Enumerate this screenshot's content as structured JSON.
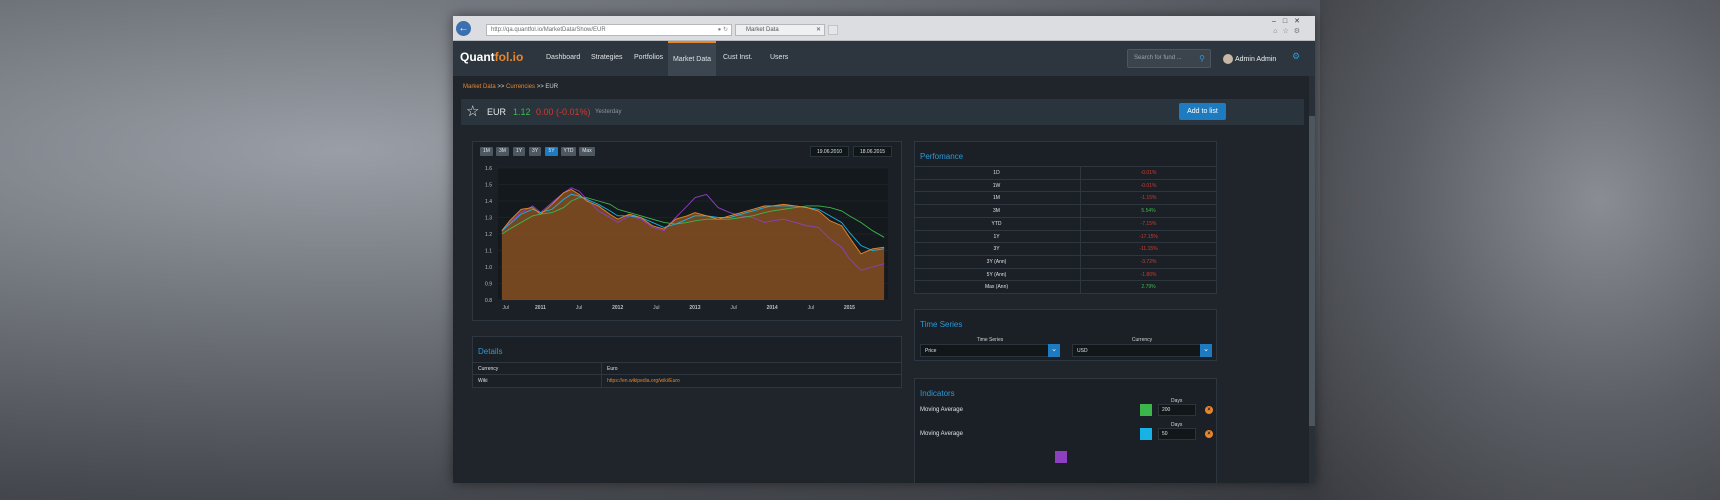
{
  "browser": {
    "address": "http://qa.quantfol.io/MarketData/Show/EUR",
    "tab_title": "Market Data"
  },
  "nav": {
    "logo_main": "Quant",
    "logo_accent": "fol.io",
    "items": [
      "Dashboard",
      "Strategies",
      "Portfolios",
      "Market Data",
      "Cust Inst.",
      "Users"
    ],
    "active": "Market Data",
    "search_placeholder": "Search for fund ...",
    "user": "Admin Admin"
  },
  "breadcrumb": {
    "level1": "Market Data",
    "sep": ">>",
    "level2": "Currencies",
    "current": "EUR"
  },
  "asset": {
    "name": "EUR",
    "price": "1.12",
    "change": "0.00 (-0.01%)",
    "date": "Yesterday",
    "add_button": "Add to list"
  },
  "chart_controls": {
    "ranges": [
      "1M",
      "3M",
      "1Y",
      "3Y",
      "5Y",
      "YTD",
      "Max"
    ],
    "active_range": "5Y",
    "from_date": "19.06.2010",
    "to_date": "18.06.2015"
  },
  "chart_data": {
    "type": "area",
    "yticks": [
      "1.6",
      "1.5",
      "1.4",
      "1.3",
      "1.2",
      "1.1",
      "1.0",
      "0.9",
      "0.8"
    ],
    "xticks": [
      "Jul",
      "2011",
      "Jul",
      "2012",
      "Jul",
      "2013",
      "Jul",
      "2014",
      "Jul",
      "2015"
    ],
    "ylim": [
      0.8,
      1.6
    ],
    "x": [
      2010.5,
      2010.6,
      2010.75,
      2010.9,
      2011.0,
      2011.15,
      2011.3,
      2011.4,
      2011.5,
      2011.6,
      2011.75,
      2011.9,
      2012.0,
      2012.15,
      2012.3,
      2012.45,
      2012.6,
      2012.75,
      2012.9,
      2013.0,
      2013.15,
      2013.3,
      2013.45,
      2013.6,
      2013.75,
      2013.9,
      2014.0,
      2014.15,
      2014.3,
      2014.45,
      2014.6,
      2014.75,
      2014.9,
      2015.0,
      2015.15,
      2015.3,
      2015.45
    ],
    "series": [
      {
        "values": [
          1.22,
          1.28,
          1.35,
          1.36,
          1.32,
          1.38,
          1.45,
          1.47,
          1.44,
          1.4,
          1.37,
          1.32,
          1.29,
          1.32,
          1.3,
          1.25,
          1.23,
          1.29,
          1.31,
          1.33,
          1.31,
          1.29,
          1.31,
          1.33,
          1.35,
          1.37,
          1.37,
          1.38,
          1.37,
          1.36,
          1.34,
          1.28,
          1.25,
          1.18,
          1.08,
          1.11,
          1.12
        ],
        "color": "#e8862e"
      },
      {
        "values": [
          1.22,
          1.26,
          1.32,
          1.35,
          1.33,
          1.35,
          1.41,
          1.44,
          1.43,
          1.41,
          1.38,
          1.34,
          1.31,
          1.31,
          1.3,
          1.27,
          1.24,
          1.26,
          1.29,
          1.31,
          1.31,
          1.3,
          1.3,
          1.32,
          1.34,
          1.36,
          1.37,
          1.37,
          1.37,
          1.36,
          1.35,
          1.31,
          1.27,
          1.21,
          1.13,
          1.1,
          1.11
        ],
        "color": "#17b3e6"
      },
      {
        "values": [
          1.2,
          1.23,
          1.27,
          1.31,
          1.32,
          1.33,
          1.36,
          1.4,
          1.42,
          1.42,
          1.4,
          1.38,
          1.35,
          1.33,
          1.31,
          1.29,
          1.27,
          1.26,
          1.27,
          1.28,
          1.29,
          1.29,
          1.29,
          1.3,
          1.31,
          1.33,
          1.34,
          1.35,
          1.36,
          1.37,
          1.37,
          1.36,
          1.34,
          1.31,
          1.27,
          1.22,
          1.18
        ],
        "color": "#3cb54a"
      },
      {
        "values": [
          1.21,
          1.27,
          1.33,
          1.37,
          1.33,
          1.39,
          1.45,
          1.48,
          1.46,
          1.41,
          1.34,
          1.3,
          1.27,
          1.31,
          1.29,
          1.24,
          1.22,
          1.3,
          1.37,
          1.42,
          1.44,
          1.36,
          1.33,
          1.31,
          1.3,
          1.27,
          1.28,
          1.29,
          1.27,
          1.25,
          1.24,
          1.17,
          1.12,
          1.05,
          0.98,
          1.0,
          1.02
        ],
        "color": "#8e3fbf"
      }
    ]
  },
  "details": {
    "title": "Details",
    "rows": [
      {
        "key": "Currency",
        "value": "Euro"
      },
      {
        "key": "Wiki",
        "value": "https://en.wikipedia.org/wiki/Euro"
      }
    ]
  },
  "performance": {
    "title": "Perfomance",
    "rows": [
      {
        "period": "1D",
        "value": "-0.01%",
        "color": "#d23a30"
      },
      {
        "period": "1W",
        "value": "-0.01%",
        "color": "#d23a30"
      },
      {
        "period": "1M",
        "value": "-1.15%",
        "color": "#d23a30"
      },
      {
        "period": "3M",
        "value": "5.54%",
        "color": "#3bba4a"
      },
      {
        "period": "YTD",
        "value": "-7.15%",
        "color": "#d23a30"
      },
      {
        "period": "1Y",
        "value": "-17.15%",
        "color": "#d23a30"
      },
      {
        "period": "3Y",
        "value": "-11.15%",
        "color": "#d23a30"
      },
      {
        "period": "3Y (Ann)",
        "value": "-3.72%",
        "color": "#d23a30"
      },
      {
        "period": "5Y (Ann)",
        "value": "-1.80%",
        "color": "#d23a30"
      },
      {
        "period": "Max (Ann)",
        "value": "2.79%",
        "color": "#3bba4a"
      }
    ]
  },
  "time_series": {
    "title": "Time Series",
    "series_label": "Time Series",
    "series_value": "Price",
    "currency_label": "Currency",
    "currency_value": "USD"
  },
  "indicators": {
    "title": "Indicators",
    "days_label": "Days",
    "rows": [
      {
        "name": "Moving Average",
        "days": "200",
        "color": "#3cb54a"
      },
      {
        "name": "Moving Average",
        "days": "50",
        "color": "#17b3e6"
      }
    ],
    "partial_color": "#8e3fbf"
  }
}
